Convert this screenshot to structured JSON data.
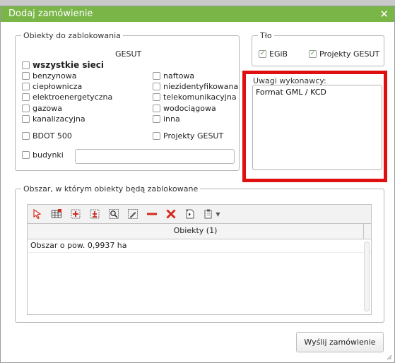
{
  "dialog": {
    "title": "Dodaj zamówienie",
    "close_glyph": "✕"
  },
  "objects_group": {
    "legend": "Obiekty do zablokowania",
    "gesut_header": "GESUT",
    "all_networks": "wszystkie sieci",
    "left_items": [
      "benzynowa",
      "ciepłownicza",
      "elektroenergetyczna",
      "gazowa",
      "kanalizacyjna"
    ],
    "right_items": [
      "naftowa",
      "niezidentyfikowana",
      "telekomunikacyjna",
      "wodociągowa",
      "inna"
    ],
    "bdot": "BDOT 500",
    "projekty_gesut": "Projekty GESUT",
    "budynki": "budynki",
    "budynki_value": ""
  },
  "background_group": {
    "legend": "Tło",
    "egib": "EGiB",
    "projekty_gesut": "Projekty GESUT",
    "check_glyph": "✓"
  },
  "notes": {
    "label": "Uwagi wykonawcy:",
    "value": "Format GML / KCD"
  },
  "area_group": {
    "legend": "Obszar, w którym obiekty będą zablokowane",
    "toolbar_icons": [
      "select-pointer-icon",
      "table-icon",
      "add-point-icon",
      "add-center-icon",
      "zoom-extent-icon",
      "edit-geometry-icon",
      "remove-icon",
      "delete-icon",
      "import-icon",
      "paste-menu-icon"
    ],
    "column_header": "Obiekty (1)",
    "rows": [
      "Obszar o pow. 0,9937 ha"
    ]
  },
  "actions": {
    "submit": "Wyślij zamówienie"
  },
  "colors": {
    "title_bar": "#79b547",
    "highlight": "#e11010",
    "red_icon": "#d32a1e"
  }
}
